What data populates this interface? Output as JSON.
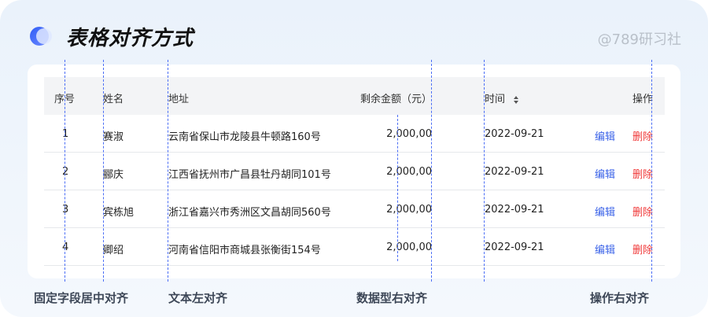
{
  "title": "表格对齐方式",
  "brand": "@789研习社",
  "table": {
    "headers": {
      "index": "序号",
      "name": "姓名",
      "address": "地址",
      "balance": "剩余金额（元）",
      "time": "时间",
      "actions": "操作"
    },
    "rows": [
      {
        "index": "1",
        "name": "赛淑",
        "address": "云南省保山市龙陵县牛顿路160号",
        "balance": "2,000,00",
        "time": "2022-09-21",
        "edit": "编辑",
        "delete": "删除"
      },
      {
        "index": "2",
        "name": "郦庆",
        "address": "江西省抚州市广昌县牡丹胡同101号",
        "balance": "2,000,00",
        "time": "2022-09-21",
        "edit": "编辑",
        "delete": "删除"
      },
      {
        "index": "3",
        "name": "宾栋旭",
        "address": "浙江省嘉兴市秀洲区文昌胡同560号",
        "balance": "2,000,00",
        "time": "2022-09-21",
        "edit": "编辑",
        "delete": "删除"
      },
      {
        "index": "4",
        "name": "卿绍",
        "address": "河南省信阳市商城县张衡街154号",
        "balance": "2,000,00",
        "time": "2022-09-21",
        "edit": "编辑",
        "delete": "删除"
      }
    ]
  },
  "captions": {
    "fixed": "固定字段居中对齐",
    "text": "文本左对齐",
    "numeric": "数据型右对齐",
    "actions": "操作右对齐"
  },
  "icons": {
    "logo": "logo-icon",
    "sort": "sort-icon"
  },
  "colors": {
    "edit": "#3b63e8",
    "delete": "#f03a3a",
    "guide": "#4b6ef5"
  }
}
